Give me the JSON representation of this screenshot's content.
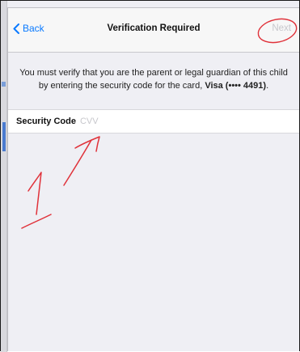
{
  "navbar": {
    "back_label": "Back",
    "title": "Verification Required",
    "next_label": "Next"
  },
  "message": {
    "text_before_card": "You must verify that you are the parent or legal guardian of this child by entering the security code for the card, ",
    "card": "Visa (•••• 4491)",
    "text_after_card": "."
  },
  "form": {
    "security_code_label": "Security Code",
    "security_code_placeholder": "CVV",
    "security_code_value": ""
  },
  "icons": {
    "back": "chevron-left-icon"
  },
  "colors": {
    "accent": "#0a7aff",
    "disabled": "#c7c7cc",
    "annotation": "#e0323a"
  },
  "annotation": {
    "number": "1"
  }
}
